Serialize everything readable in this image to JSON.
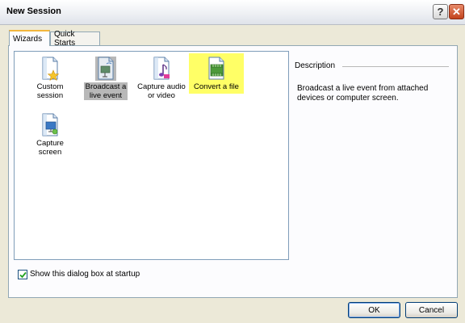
{
  "window": {
    "title": "New Session",
    "help_glyph": "?",
    "close_glyph": "✕"
  },
  "tabs": [
    {
      "label": "Wizards",
      "selected": true
    },
    {
      "label": "Quick Starts",
      "selected": false
    }
  ],
  "wizards": [
    {
      "line1": "Custom",
      "line2": "session",
      "icon": "custom-session-icon",
      "state": "normal"
    },
    {
      "line1": "Broadcast a",
      "line2": "live event",
      "icon": "broadcast-icon",
      "state": "selected"
    },
    {
      "line1": "Capture audio",
      "line2": "or video",
      "icon": "capture-audio-video-icon",
      "state": "normal"
    },
    {
      "line1": "Convert a file",
      "line2": "",
      "icon": "convert-file-icon",
      "state": "hover"
    },
    {
      "line1": "Capture",
      "line2": "screen",
      "icon": "capture-screen-icon",
      "state": "normal"
    }
  ],
  "description": {
    "heading": "Description",
    "text": "Broadcast a live event from attached devices or computer screen."
  },
  "startup_checkbox": {
    "label": "Show this dialog box at startup",
    "checked": true
  },
  "buttons": {
    "ok": "OK",
    "cancel": "Cancel"
  },
  "colors": {
    "dialog_bg": "#ece9d8",
    "tab_accent": "#f2b63c",
    "hover_highlight": "#ffff66",
    "selected_highlight": "#b8b8b8"
  }
}
